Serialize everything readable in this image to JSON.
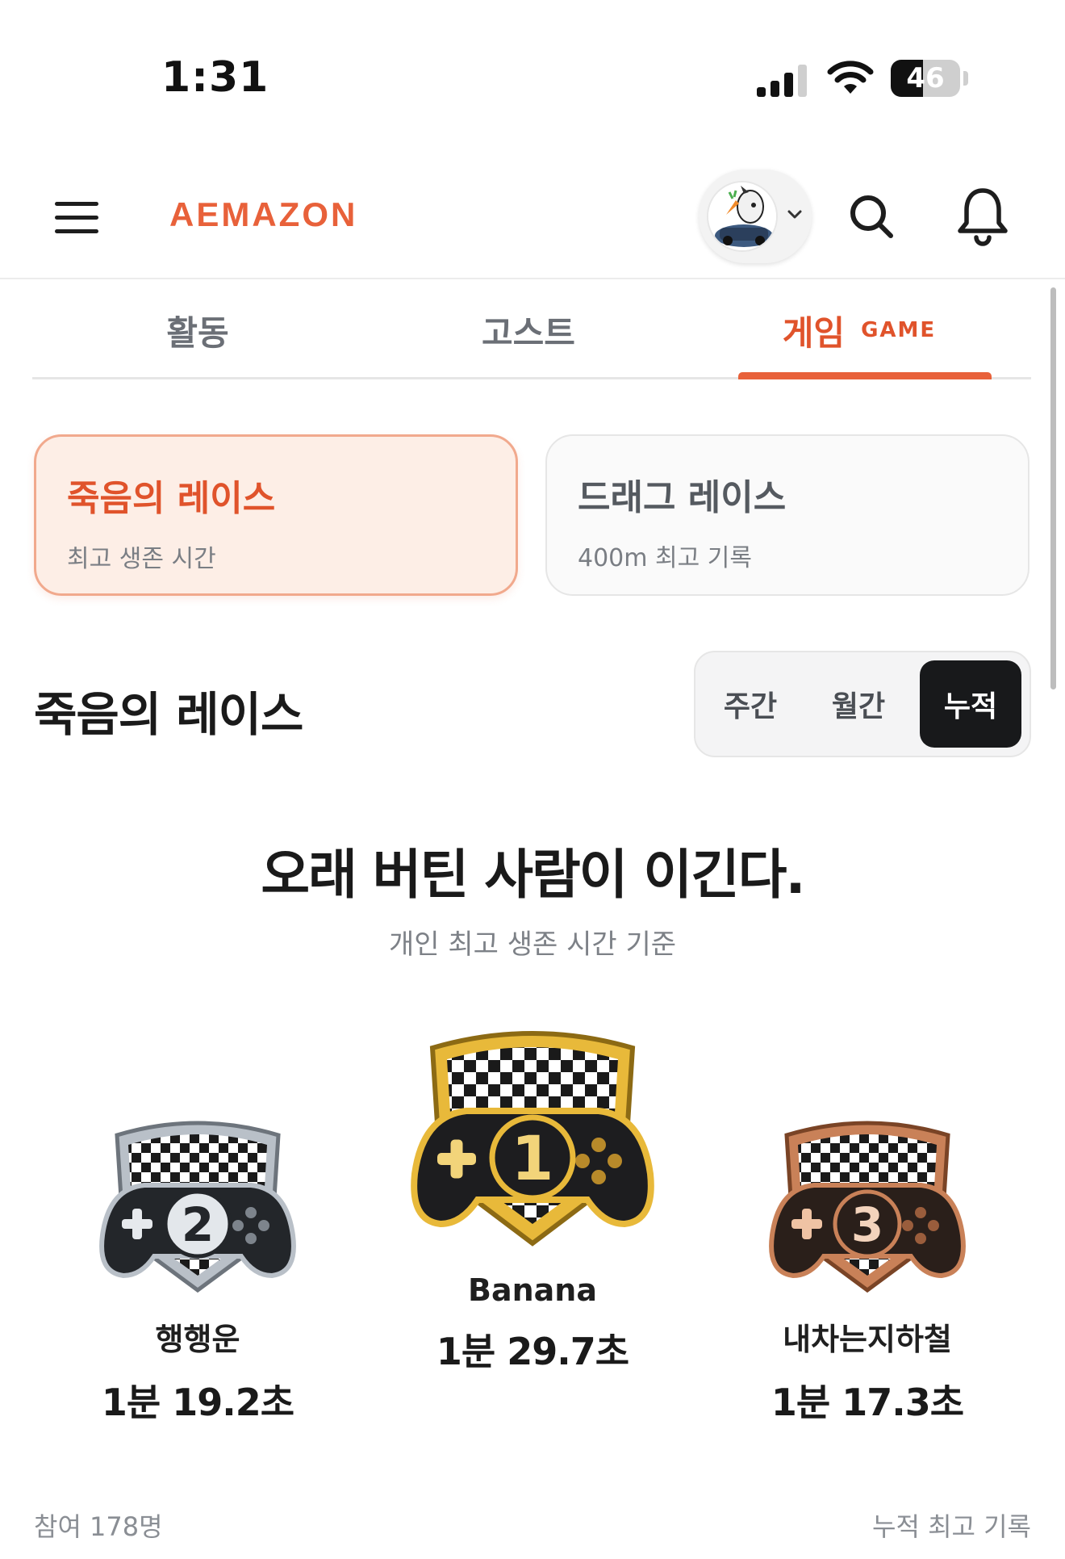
{
  "status_bar": {
    "time": "1:31",
    "battery_percent": "46",
    "battery_level": 0.46,
    "icons": [
      "signal-icon",
      "wifi-icon",
      "battery-icon"
    ]
  },
  "header": {
    "brand": "AEMAZON",
    "icons": [
      "menu-icon",
      "avatar",
      "chevron-down-icon",
      "search-icon",
      "bell-icon"
    ]
  },
  "tabs": [
    {
      "label": "활동",
      "active": false
    },
    {
      "label": "고스트",
      "active": false
    },
    {
      "label": "게임",
      "sub": "GAME",
      "active": true
    }
  ],
  "game_cards": [
    {
      "title": "죽음의 레이스",
      "subtitle": "최고 생존 시간",
      "selected": true
    },
    {
      "title": "드래그 레이스",
      "subtitle": "400m 최고 기록",
      "selected": false
    }
  ],
  "section": {
    "title": "죽음의 레이스",
    "periods": [
      "주간",
      "월간",
      "누적"
    ],
    "selected_period": "누적"
  },
  "headline": {
    "title": "오래 버틴 사람이 이긴다.",
    "subtitle": "개인 최고 생존 시간 기준"
  },
  "podium": {
    "first": {
      "rank": "1",
      "name": "Banana",
      "time": "1분 29.7초"
    },
    "second": {
      "rank": "2",
      "name": "행행운",
      "time": "1분 19.2초"
    },
    "third": {
      "rank": "3",
      "name": "내차는지하철",
      "time": "1분 17.3초"
    }
  },
  "footer": {
    "participants": "참여 178명",
    "record_type": "누적 최고 기록"
  },
  "colors": {
    "accent": "#e8613a",
    "gold": "#e8b93a",
    "silver": "#b9c0c8",
    "bronze": "#c98158",
    "dark": "#18191b"
  }
}
